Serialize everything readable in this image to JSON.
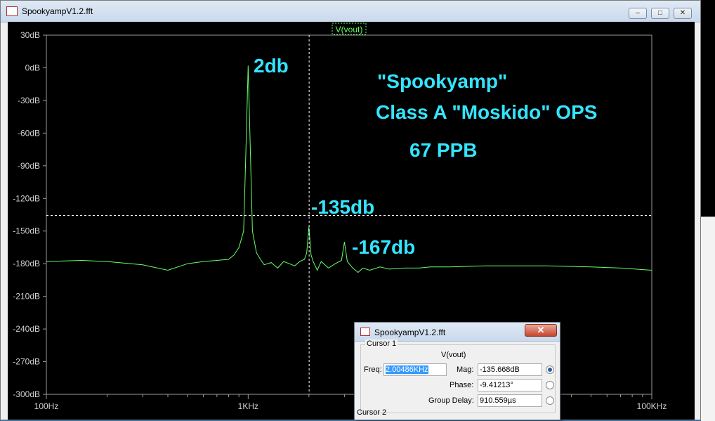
{
  "window": {
    "title": "SpookyampV1.2.fft",
    "controls": {
      "minimize": "–",
      "maximize": "□",
      "close": "✕"
    }
  },
  "colors": {
    "trace": "#66ff66",
    "annotation": "#33e5ff",
    "axis_text": "#d0d0d0",
    "background": "#000000"
  },
  "trace_label": "V(vout)",
  "annotations": {
    "peak": "2db",
    "harmonic2": "-135db",
    "harmonic3": "-167db",
    "name": "\"Spookyamp\"",
    "subtitle": "Class A \"Moskido\" OPS",
    "ppb": "67 PPB"
  },
  "chart_data": {
    "type": "line",
    "x_scale": "log",
    "xlim": [
      100,
      100000
    ],
    "ylim": [
      -300,
      30
    ],
    "x_ticks": [
      "100Hz",
      "1KHz",
      "100KHz"
    ],
    "x_tick_values": [
      100,
      1000,
      100000
    ],
    "y_ticks": [
      "30dB",
      "0dB",
      "-30dB",
      "-60dB",
      "-90dB",
      "-120dB",
      "-150dB",
      "-180dB",
      "-210dB",
      "-240dB",
      "-270dB",
      "-300dB"
    ],
    "y_tick_values": [
      30,
      0,
      -30,
      -60,
      -90,
      -120,
      -150,
      -180,
      -210,
      -240,
      -270,
      -300
    ],
    "series": [
      {
        "name": "V(vout)",
        "x": [
          100,
          150,
          200,
          300,
          400,
          500,
          600,
          700,
          800,
          850,
          900,
          950,
          980,
          1000,
          1020,
          1050,
          1100,
          1150,
          1200,
          1300,
          1400,
          1500,
          1600,
          1700,
          1800,
          1900,
          1950,
          2000,
          2050,
          2100,
          2200,
          2300,
          2500,
          2700,
          2900,
          3000,
          3100,
          3300,
          3500,
          3700,
          4000,
          4500,
          5000,
          6000,
          7000,
          8000,
          10000,
          15000,
          20000,
          30000,
          50000,
          70000,
          100000
        ],
        "y": [
          -178,
          -177,
          -178,
          -181,
          -186,
          -180,
          -178,
          -177,
          -176,
          -172,
          -165,
          -150,
          -60,
          2,
          -60,
          -150,
          -170,
          -176,
          -181,
          -179,
          -184,
          -178,
          -180,
          -182,
          -178,
          -176,
          -170,
          -146,
          -172,
          -178,
          -186,
          -178,
          -184,
          -180,
          -177,
          -160,
          -178,
          -184,
          -188,
          -184,
          -186,
          -183,
          -185,
          -184,
          -184,
          -183,
          -183,
          -182,
          -182,
          -182,
          -183,
          -184,
          -186
        ]
      }
    ],
    "cursor": {
      "x": 2004.86,
      "y": -135.668
    }
  },
  "cursor_dialog": {
    "title": "SpookyampV1.2.fft",
    "close": "✕",
    "cursor1_label": "Cursor 1",
    "cursor2_label": "Cursor 2",
    "trace": "V(vout)",
    "freq_label": "Freq:",
    "freq_value": "2.00486KHz",
    "mag_label": "Mag:",
    "mag_value": "-135.668dB",
    "phase_label": "Phase:",
    "phase_value": "-9.41213°",
    "group_delay_label": "Group Delay:",
    "group_delay_value": "910.559µs"
  }
}
